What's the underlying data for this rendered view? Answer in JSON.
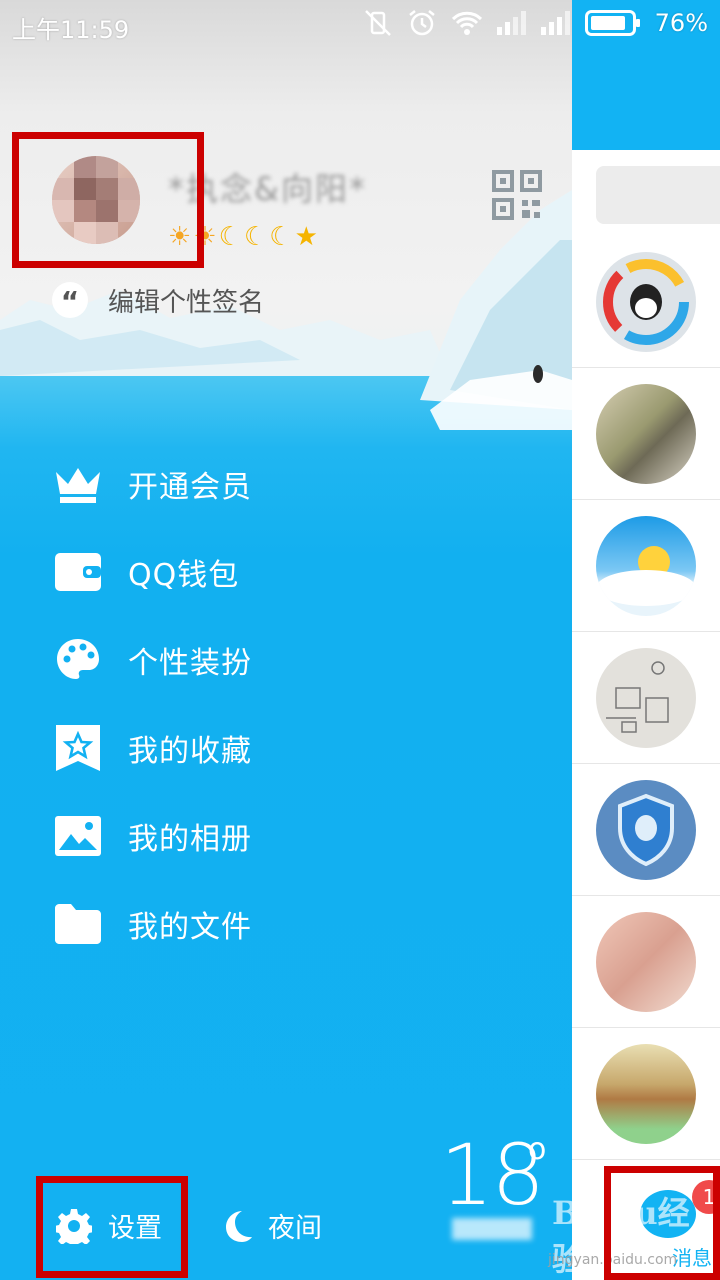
{
  "status_bar": {
    "time": "上午11:59",
    "battery": "76%"
  },
  "profile": {
    "nickname": "*执念&向阳*",
    "level_icons": [
      "sun",
      "sun",
      "moon",
      "moon",
      "moon",
      "star"
    ],
    "signature_placeholder": "编辑个性签名"
  },
  "menu": {
    "items": [
      {
        "label": "开通会员",
        "icon": "crown-icon"
      },
      {
        "label": "QQ钱包",
        "icon": "wallet-icon"
      },
      {
        "label": "个性装扮",
        "icon": "palette-icon"
      },
      {
        "label": "我的收藏",
        "icon": "favorites-icon"
      },
      {
        "label": "我的相册",
        "icon": "album-icon"
      },
      {
        "label": "我的文件",
        "icon": "folder-icon"
      }
    ]
  },
  "bottom": {
    "settings_label": "设置",
    "night_label": "夜间",
    "weather_temp": "18",
    "weather_unit": "o"
  },
  "strip": {
    "messages_label": "消息",
    "badge_count": "1"
  },
  "watermark": {
    "brand": "Baidu经验",
    "url": "jingyan.baidu.com"
  },
  "colors": {
    "accent": "#12b3f3",
    "highlight": "#cc0000",
    "badge": "#f04a4a"
  }
}
